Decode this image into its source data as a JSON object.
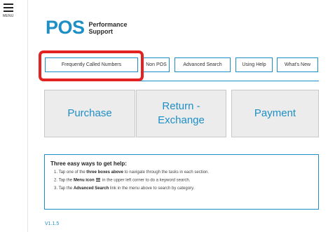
{
  "menu": {
    "label": "MENU"
  },
  "logo": {
    "brand": "POS",
    "sub_line1": "Performance",
    "sub_line2": "Support"
  },
  "nav": {
    "items": [
      {
        "label": "Frequently Called Numbers"
      },
      {
        "label": "Non POS"
      },
      {
        "label": "Advanced Search"
      },
      {
        "label": "Using Help"
      },
      {
        "label": "What's New"
      }
    ]
  },
  "tiles": [
    {
      "label": "Purchase"
    },
    {
      "label_line1": "Return -",
      "label_line2": "Exchange"
    },
    {
      "label": "Payment"
    }
  ],
  "help": {
    "title": "Three easy ways to get help:",
    "step1": {
      "num": "1.",
      "pre": "Tap one of the",
      "bold": "three boxes above",
      "post": "to navigate through the tasks in each section."
    },
    "step2": {
      "num": "2.",
      "pre": "Tap the",
      "bold": "Menu icon",
      "post": "in the upper left corner to do a keyword search."
    },
    "step3": {
      "num": "3.",
      "pre": "Tap the",
      "bold": "Advanced Search",
      "post": "link in the menu above to search by category."
    }
  },
  "version": "V1.1.5",
  "colors": {
    "accent": "#1e8fc6",
    "highlight": "#e32222",
    "tile_bg": "#ececec"
  }
}
